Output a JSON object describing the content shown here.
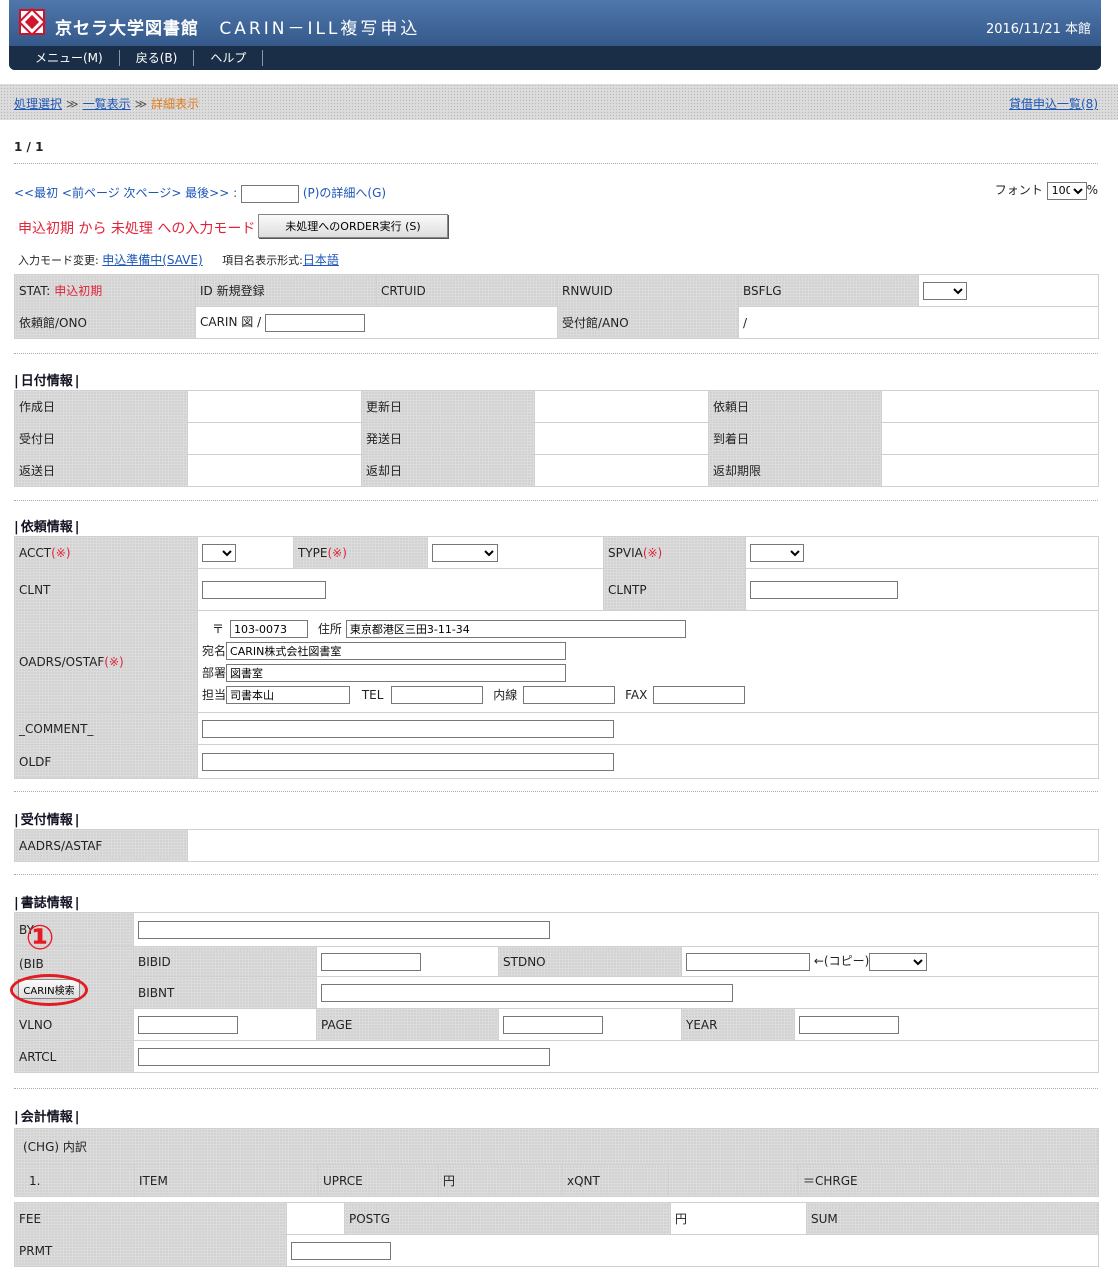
{
  "header": {
    "library": "京セラ大学図書館",
    "app_title": "CARIN－ILL複写申込",
    "date_location": "2016/11/21 本館",
    "menu": [
      "メニュー(M)",
      "戻る(B)",
      "ヘルプ"
    ]
  },
  "breadcrumb": {
    "items": [
      "処理選択",
      "一覧表示",
      "詳細表示"
    ],
    "sep": "≫",
    "right_link": "貸借申込一覧(8)"
  },
  "paging": {
    "count": "1 / 1",
    "nav": "<<最初 <前ページ 次ページ> 最後>> :",
    "detail_suffix": "(P)の詳細へ(G)",
    "font_label": "フォント",
    "font_value": "100",
    "percent": "%"
  },
  "mode": {
    "text": "申込初期 から 未処理 への入力モード",
    "order_button": "未処理へのORDER実行 (S)",
    "change_label": "入力モード変更:",
    "change_link": "申込準備中(SAVE)",
    "display_label": "項目名表示形式:",
    "display_link": "日本語"
  },
  "status": {
    "stat_label": "STAT:",
    "stat_value": "申込初期",
    "id_label": "ID",
    "id_value": "新規登録",
    "crtuid": "CRTUID",
    "rnwuid": "RNWUID",
    "bsflg": "BSFLG",
    "ono_label": "依頼館/ONO",
    "ono_prefix": "CARIN 図 /",
    "ano_label": "受付館/ANO",
    "ano_value": "/"
  },
  "dates": {
    "title": "日付情報",
    "labels": [
      "作成日",
      "更新日",
      "依頼日",
      "受付日",
      "発送日",
      "到着日",
      "返送日",
      "返却日",
      "返却期限"
    ]
  },
  "request": {
    "title": "依頼情報",
    "acct": "ACCT",
    "type": "TYPE",
    "spvia": "SPVIA",
    "req_mark": "(※)",
    "clnt": "CLNT",
    "clntp": "CLNTP",
    "oadrs": "OADRS/OSTAF",
    "postal_mark": "〒",
    "postal_value": "103-0073",
    "addr_label": "住所",
    "addr_value": "東京都港区三田3-11-34",
    "name_label": "宛名",
    "name_value": "CARIN株式会社図書室",
    "dept_label": "部署",
    "dept_value": "図書室",
    "staff_label": "担当",
    "staff_value": "司書本山",
    "tel": "TEL",
    "ext": "内線",
    "fax": "FAX",
    "comment": "_COMMENT_",
    "oldf": "OLDF"
  },
  "accept": {
    "title": "受付情報",
    "aadrs": "AADRS/ASTAF"
  },
  "biblio": {
    "title": "書誌情報",
    "by": "BY",
    "bib": "(BIB",
    "bibid": "BIBID",
    "stdno": "STDNO",
    "copy": "←(コピー)",
    "carin_button": "CARIN検索",
    "bibnt": "BIBNT",
    "vlno": "VLNO",
    "page": "PAGE",
    "year": "YEAR",
    "artcl": "ARTCL",
    "callout": "①"
  },
  "account": {
    "title": "会計情報",
    "chg": "(CHG)  内訳",
    "row_no": "1.",
    "item": "ITEM",
    "uprce": "UPRCE",
    "yen": "円",
    "qnt": "xQNT",
    "chrge": "＝CHRGE",
    "fee": "FEE",
    "postg": "POSTG",
    "sum": "SUM",
    "prmt": "PRMT"
  }
}
